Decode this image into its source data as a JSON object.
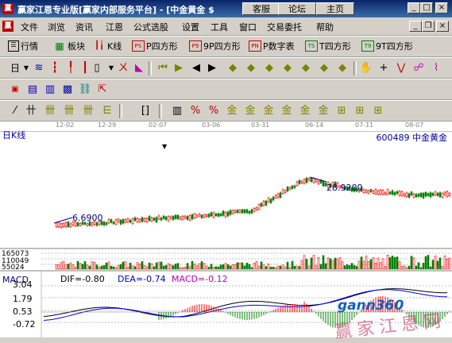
{
  "window": {
    "title": "赢家江恩专业版[赢家内部服务平台] - [中金黄金  $",
    "app_icon": "赢",
    "top_buttons": [
      "客服",
      "论坛",
      "主页"
    ],
    "controls": {
      "minimize": "_",
      "maximize": "□",
      "close": "×"
    }
  },
  "menu": {
    "doc_icon": "赢",
    "items": [
      "文件",
      "浏览",
      "资讯",
      "江恩",
      "公式选股",
      "设置",
      "工具",
      "窗口",
      "交易委托",
      "帮助"
    ],
    "mdi_controls": {
      "minimize": "_",
      "restore": "❐",
      "close": "×"
    }
  },
  "toolbar1": {
    "items": [
      {
        "icon": "list-icon",
        "label": "行情"
      },
      {
        "icon": "grid-icon",
        "label": "板块"
      },
      {
        "icon": "candlestick-icon",
        "label": "K线"
      },
      {
        "icon": "ps-icon",
        "label": "P四方形",
        "badge": "PS"
      },
      {
        "icon": "p9-icon",
        "label": "9P四方形",
        "badge": "P9"
      },
      {
        "icon": "pn-icon",
        "label": "P数字表",
        "badge": "PN"
      },
      {
        "icon": "ts-icon",
        "label": "T四方形",
        "badge": "TS"
      },
      {
        "icon": "t9-icon",
        "label": "9T四方形",
        "badge": "T9"
      }
    ]
  },
  "toolbar2": {
    "period": "日",
    "icons": [
      "dropdown-arrow",
      "wave-icon",
      "bars-icon",
      "candles-icon",
      "volume-icon",
      "gann-icon",
      "flag-icon",
      "first-icon",
      "prev-page-icon",
      "prev-icon",
      "next-icon",
      "up-icon",
      "zoom-in-icon",
      "zoom-out-icon",
      "left-icon",
      "right-icon",
      "expand-icon",
      "shrink-icon",
      "hand-icon",
      "cross-icon",
      "line-icon",
      "tool-icon"
    ]
  },
  "toolbar3": {
    "icons": [
      "calendar-icon",
      "table-icon",
      "document-icon",
      "save-icon",
      "network-icon",
      "export-icon"
    ]
  },
  "toolbar4": {
    "icons": [
      "gann-fan-icon",
      "gann-grid-icon",
      "gann-box-icon",
      "gann-square-icon",
      "gann-wheel-icon",
      "gann-angle-icon",
      "bracket-icon",
      "bars2-icon",
      "percent-icon",
      "fib-icon",
      "gold-icon",
      "gold2-icon",
      "gold3-icon",
      "arc-icon",
      "speed-icon",
      "cycle-icon",
      "spiral-icon",
      "time-icon"
    ]
  },
  "chart": {
    "period_label": "日K线",
    "stock": "600489  中金黄金",
    "dates": [
      "12-02",
      "12-29",
      "02-07",
      "03-06",
      "03-31",
      "06-14",
      "07-11",
      "08-07"
    ],
    "low_label": "6.6900",
    "high_label": "28.9200",
    "volume_ticks": [
      "165073",
      "110049",
      "55024"
    ],
    "macd": {
      "title": "MACD",
      "dif": "DIF=-0.80",
      "dea": "DEA=-0.74",
      "macd": "MACD=-0.12",
      "ticks": [
        "3.04",
        "1.79",
        "0.53",
        "-0.72"
      ]
    },
    "watermark": "gann360",
    "watermark_cn": "赢家江恩网"
  },
  "chart_data": {
    "type": "line",
    "title": "",
    "xlabel": "",
    "ylabel": "",
    "x": [
      "12-02",
      "12-29",
      "02-07",
      "03-06",
      "03-31",
      "06-14",
      "07-11",
      "08-07"
    ],
    "series": [
      {
        "values": [
          6.69,
          7.5,
          9.5,
          11.0,
          13.5,
          28.92,
          24.0,
          21.5
        ]
      }
    ]
  },
  "colors": {
    "up": "#ff0000",
    "down": "#008000",
    "dif": "#000000",
    "dea": "#0000ff",
    "macd": "#cc00cc",
    "label": "#000080"
  }
}
